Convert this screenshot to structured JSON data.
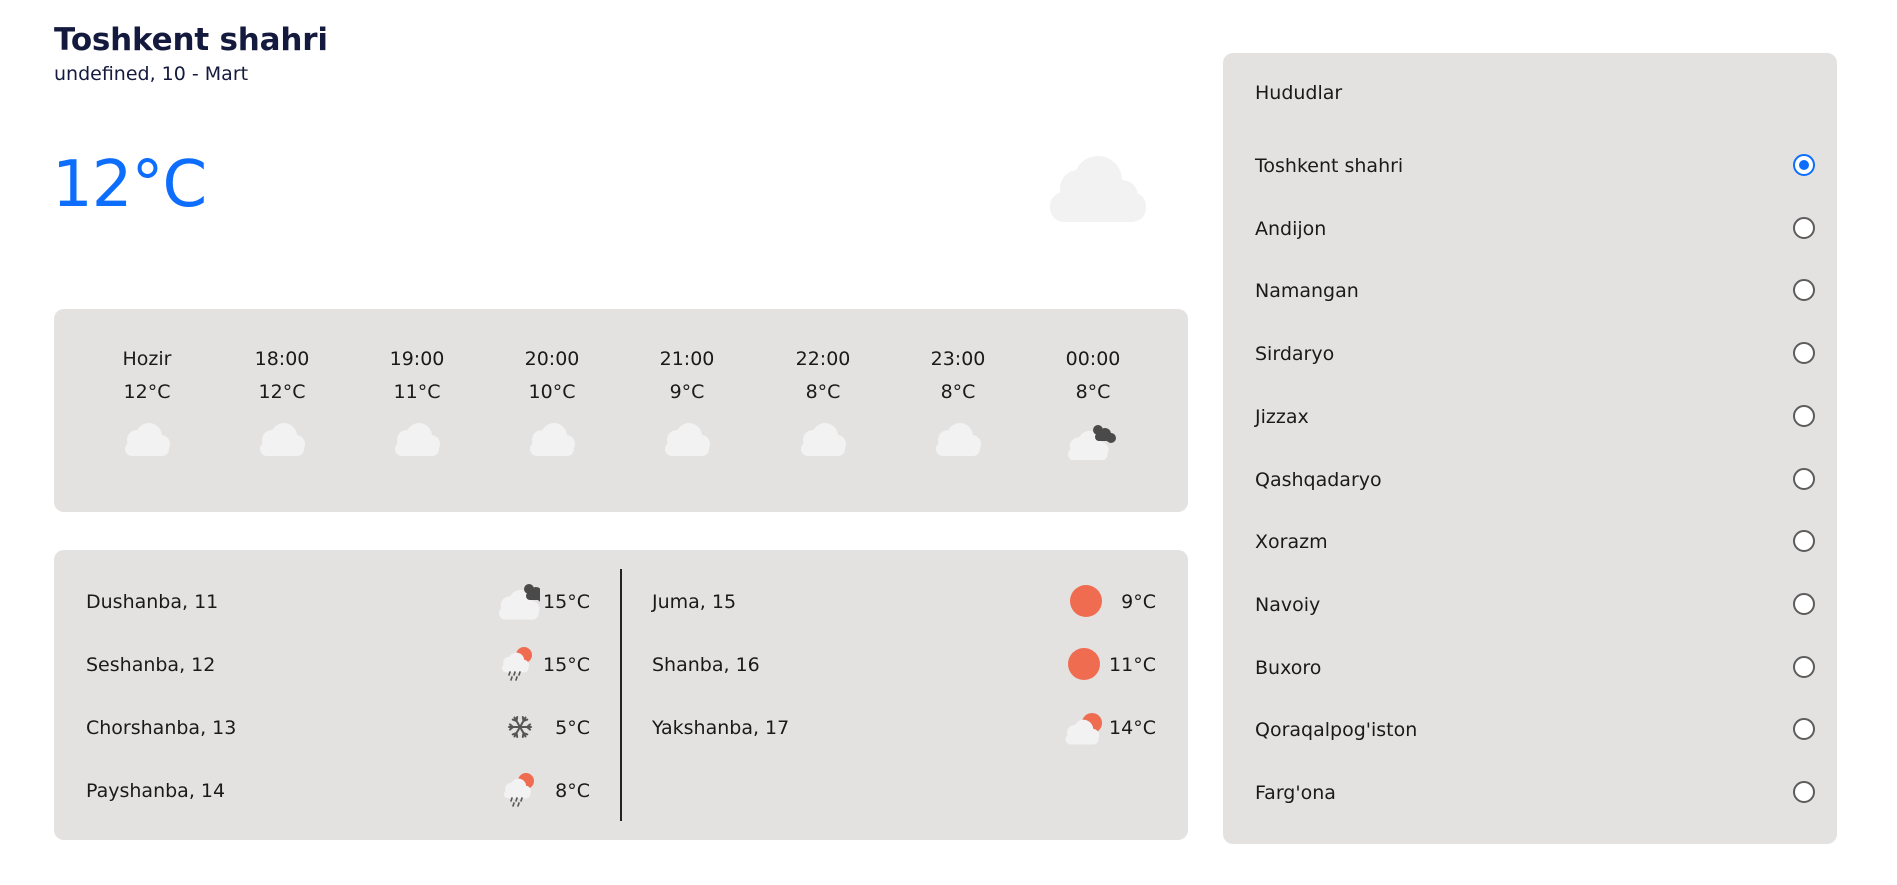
{
  "header": {
    "city": "Toshkent shahri",
    "date": "undefined, 10 - Mart"
  },
  "current": {
    "temp": "12°C",
    "icon": "cloud-icon"
  },
  "hourly": [
    {
      "time": "Hozir",
      "temp": "12°C",
      "icon": "cloud-icon"
    },
    {
      "time": "18:00",
      "temp": "12°C",
      "icon": "cloud-icon"
    },
    {
      "time": "19:00",
      "temp": "11°C",
      "icon": "cloud-icon"
    },
    {
      "time": "20:00",
      "temp": "10°C",
      "icon": "cloud-icon"
    },
    {
      "time": "21:00",
      "temp": "9°C",
      "icon": "cloud-icon"
    },
    {
      "time": "22:00",
      "temp": "8°C",
      "icon": "cloud-icon"
    },
    {
      "time": "23:00",
      "temp": "8°C",
      "icon": "cloud-icon"
    },
    {
      "time": "00:00",
      "temp": "8°C",
      "icon": "dark-clouds-icon"
    }
  ],
  "daily": [
    {
      "name": "Dushanba, 11",
      "temp": "15°C",
      "icon": "dark-clouds-icon"
    },
    {
      "name": "Seshanba, 12",
      "temp": "15°C",
      "icon": "rain-sun-icon"
    },
    {
      "name": "Chorshanba, 13",
      "temp": "5°C",
      "icon": "snowflake-icon"
    },
    {
      "name": "Payshanba, 14",
      "temp": "8°C",
      "icon": "rain-sun-icon"
    },
    {
      "name": "Juma, 15",
      "temp": "9°C",
      "icon": "sun-icon"
    },
    {
      "name": "Shanba, 16",
      "temp": "11°C",
      "icon": "sun-icon"
    },
    {
      "name": "Yakshanba, 17",
      "temp": "14°C",
      "icon": "partly-cloudy-icon"
    }
  ],
  "regions": {
    "title": "Hududlar",
    "selected": "Toshkent shahri",
    "items": [
      "Toshkent shahri",
      "Andijon",
      "Namangan",
      "Sirdaryo",
      "Jizzax",
      "Qashqadaryo",
      "Xorazm",
      "Navoiy",
      "Buxoro",
      "Qoraqalpog'iston",
      "Farg'ona"
    ]
  },
  "colors": {
    "accent": "#0d6efd",
    "panel": "#e4e1e1",
    "sun": "#ef6c50",
    "cloud": "#f2f2f2",
    "dark_cloud": "#4a4a4a"
  }
}
